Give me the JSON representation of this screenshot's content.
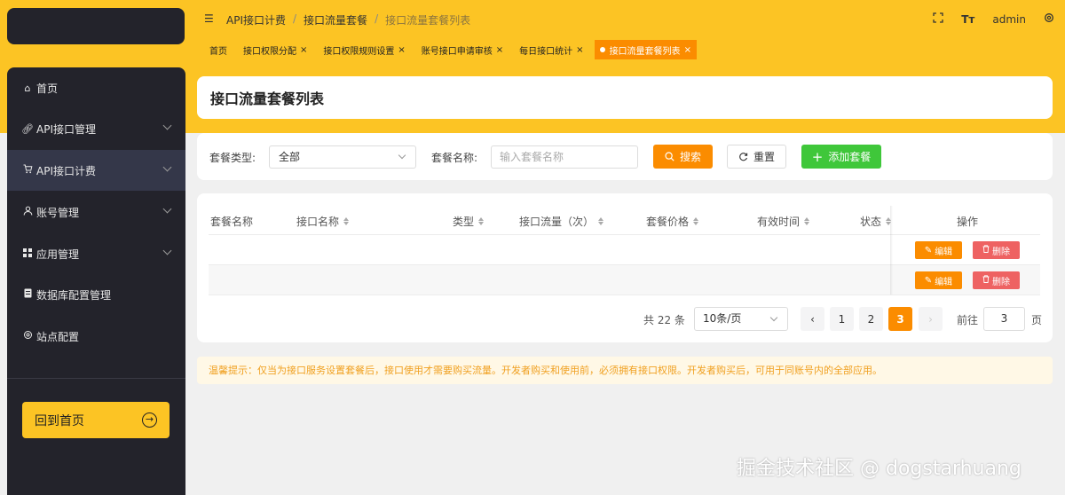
{
  "breadcrumb": {
    "item1": "API接口计费",
    "sep": "/",
    "item2": "接口流量套餐",
    "item3": "接口流量套餐列表"
  },
  "top_right": {
    "user": "admin"
  },
  "icons": {
    "menu_toggle": "outdent-icon",
    "fullscreen": "fullscreen-icon",
    "font_size": "font-size-icon",
    "settings": "gear-icon"
  },
  "tabs": [
    {
      "label": "首页",
      "closable": false
    },
    {
      "label": "接口权限分配",
      "closable": true
    },
    {
      "label": "接口权限规则设置",
      "closable": true
    },
    {
      "label": "账号接口申请审核",
      "closable": true
    },
    {
      "label": "每日接口统计",
      "closable": true
    },
    {
      "label": "接口流量套餐列表",
      "closable": true,
      "active": true
    }
  ],
  "close_glyph": "×",
  "sidebar": {
    "items": [
      {
        "label": "首页",
        "icon": "home-icon"
      },
      {
        "label": "API接口管理",
        "icon": "link-icon",
        "expandable": true
      },
      {
        "label": "API接口计费",
        "icon": "cart-icon",
        "expandable": true,
        "active": true
      },
      {
        "label": "账号管理",
        "icon": "user-icon",
        "expandable": true
      },
      {
        "label": "应用管理",
        "icon": "grid-icon",
        "expandable": true
      },
      {
        "label": "数据库配置管理",
        "icon": "database-icon"
      },
      {
        "label": "站点配置",
        "icon": "gear-icon"
      }
    ],
    "back_label": "回到首页"
  },
  "page": {
    "title": "接口流量套餐列表"
  },
  "filter": {
    "type_label": "套餐类型:",
    "type_value": "全部",
    "name_label": "套餐名称:",
    "name_placeholder": "输入套餐名称",
    "search_label": "搜索",
    "reset_label": "重置",
    "add_label": "添加套餐"
  },
  "table": {
    "columns": [
      {
        "label": "套餐名称",
        "sortable": false
      },
      {
        "label": "接口名称",
        "sortable": true
      },
      {
        "label": "类型",
        "sortable": true
      },
      {
        "label": "接口流量（次）",
        "sortable": true
      },
      {
        "label": "套餐价格",
        "sortable": true
      },
      {
        "label": "有效时间",
        "sortable": true
      },
      {
        "label": "状态",
        "sortable": true
      },
      {
        "label": "操作",
        "sortable": false
      }
    ],
    "edit_label": "编辑",
    "delete_label": "删除"
  },
  "pagination": {
    "total": "共 22 条",
    "page_size": "10条/页",
    "pages": [
      "1",
      "2",
      "3"
    ],
    "current": "3",
    "goto_label": "前往",
    "goto_value": "3",
    "page_unit": "页"
  },
  "tip": "温馨提示：仅当为接口服务设置套餐后，接口使用才需要购买流量。开发者购买和使用前，必须拥有接口权限。开发者购买后，可用于同账号内的全部应用。",
  "watermark": "掘金技术社区 @ dogstarhuang",
  "colors": {
    "brand_yellow": "#fcc424",
    "accent_orange": "#fb8c00",
    "success_green": "#3fc73a",
    "danger_red": "#ee6262",
    "sidebar_bg": "#23232b"
  }
}
